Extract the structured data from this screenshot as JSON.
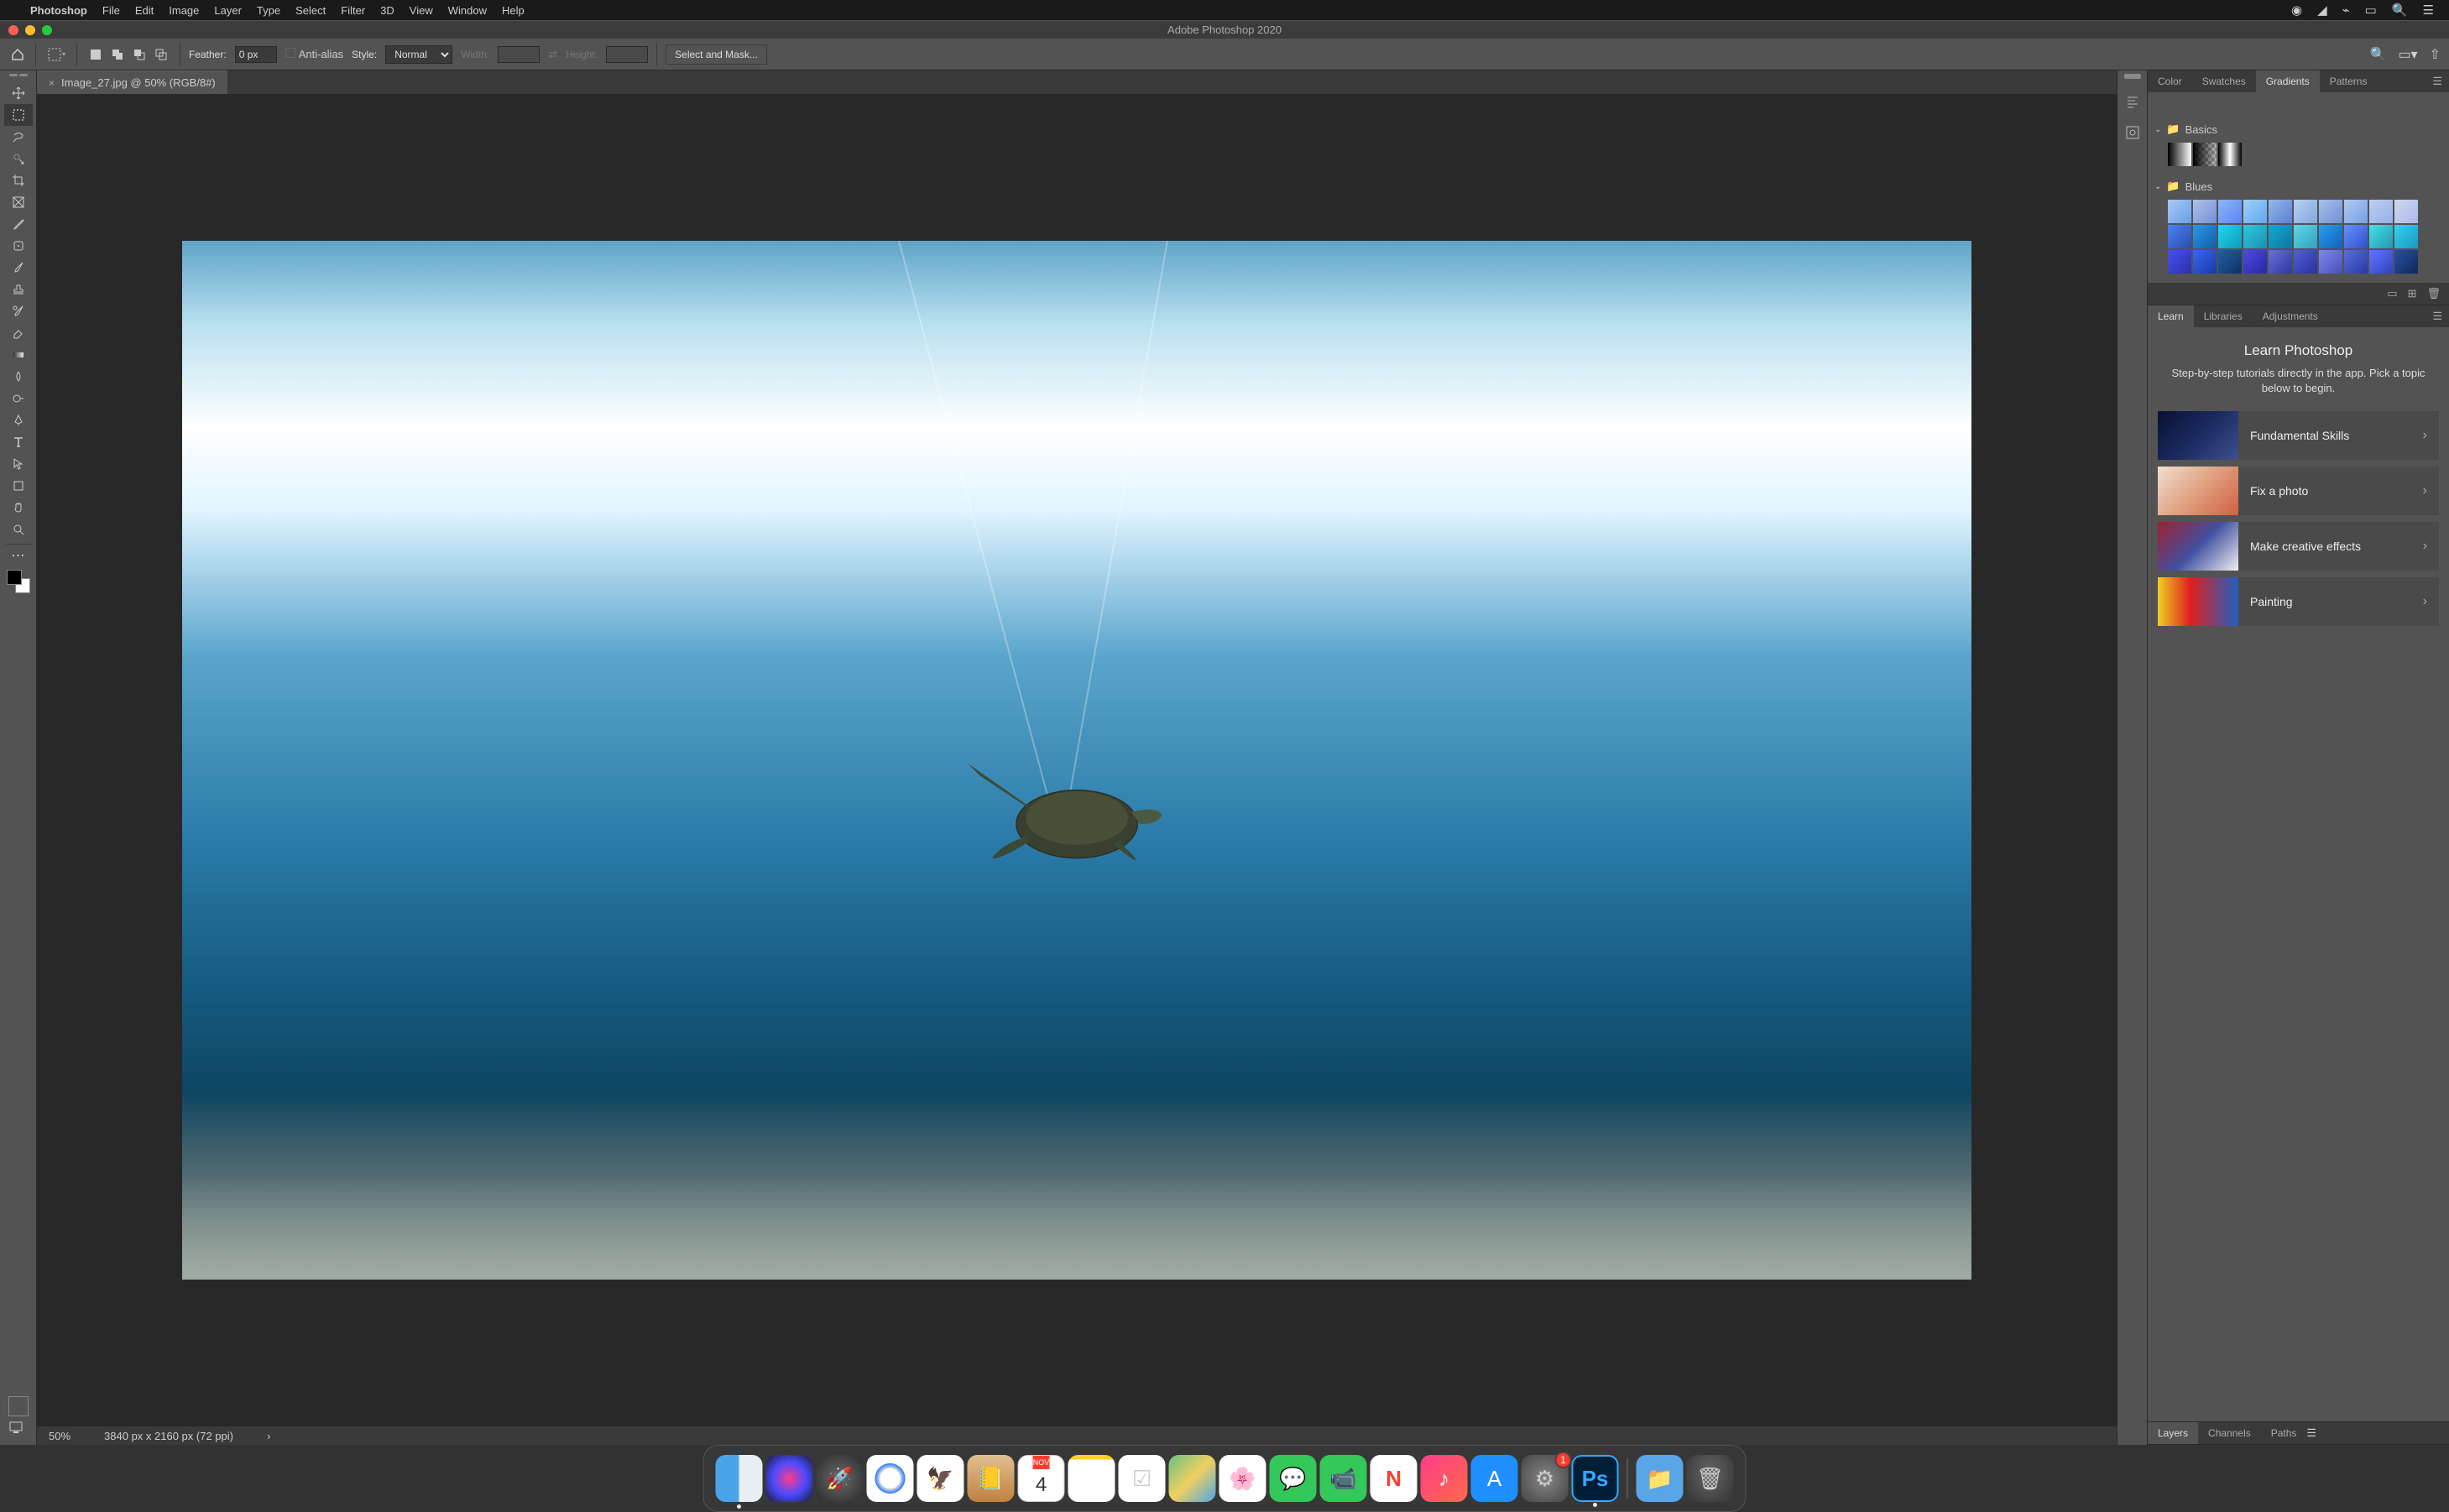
{
  "menubar": {
    "app": "Photoshop",
    "items": [
      "File",
      "Edit",
      "Image",
      "Layer",
      "Type",
      "Select",
      "Filter",
      "3D",
      "View",
      "Window",
      "Help"
    ]
  },
  "window": {
    "title": "Adobe Photoshop 2020"
  },
  "optbar": {
    "feather_label": "Feather:",
    "feather_value": "0 px",
    "antialias_label": "Anti-alias",
    "style_label": "Style:",
    "style_value": "Normal",
    "width_label": "Width:",
    "height_label": "Height:",
    "select_mask": "Select and Mask..."
  },
  "document": {
    "tab": "Image_27.jpg @ 50% (RGB/8#)",
    "zoom": "50%",
    "dim": "3840 px x 2160 px (72 ppi)"
  },
  "tools": [
    "move",
    "marquee",
    "lasso",
    "quick-select",
    "crop",
    "frame",
    "eyedropper",
    "patch",
    "brush",
    "stamp",
    "history-brush",
    "eraser",
    "gradient",
    "blur",
    "dodge",
    "pen",
    "type",
    "path-select",
    "shape",
    "hand",
    "zoom"
  ],
  "panels": {
    "top_tabs": [
      "Color",
      "Swatches",
      "Gradients",
      "Patterns"
    ],
    "gradients": {
      "folders": [
        {
          "name": "Basics",
          "swatches": [
            "gbasic1",
            "gbasic2",
            "gbasic3"
          ]
        },
        {
          "name": "Blues",
          "colors": [
            [
              "#a8c8f4",
              "#68a0e8"
            ],
            [
              "#b4c0e8",
              "#7090d8"
            ],
            [
              "#90b4f8",
              "#5888f0"
            ],
            [
              "#a0d0f8",
              "#60a8f0"
            ],
            [
              "#98b8e8",
              "#5880d8"
            ],
            [
              "#b8d0f0",
              "#80a8e0"
            ],
            [
              "#a8c0e8",
              "#7090d8"
            ],
            [
              "#b0c8f0",
              "#78a0e8"
            ],
            [
              "#c0d0f0",
              "#90b0e8"
            ],
            [
              "#d0d8f0",
              "#a8b8e8"
            ],
            [
              "#4a80f8",
              "#2a50a8"
            ],
            [
              "#2a98e8",
              "#1060a8"
            ],
            [
              "#20d8f0",
              "#1098b8"
            ],
            [
              "#30c8e0",
              "#1890b0"
            ],
            [
              "#18a8d0",
              "#0a78a0"
            ],
            [
              "#60d8e8",
              "#30a0c0"
            ],
            [
              "#28a0f0",
              "#1060b8"
            ],
            [
              "#6890ff",
              "#3050c8"
            ],
            [
              "#48e0e8",
              "#2098b0"
            ],
            [
              "#38d0f0",
              "#1898c0"
            ],
            [
              "#4a50f0",
              "#2a30a8"
            ],
            [
              "#3868f0",
              "#1838a8"
            ],
            [
              "#2060a8",
              "#103060"
            ],
            [
              "#5048e8",
              "#2828a0"
            ],
            [
              "#6870e0",
              "#30389a"
            ],
            [
              "#5060d8",
              "#283098"
            ],
            [
              "#8088f0",
              "#4850b8"
            ],
            [
              "#5870e0",
              "#2838a0"
            ],
            [
              "#6078ff",
              "#3040c0"
            ],
            [
              "#2850a8",
              "#102858"
            ]
          ]
        }
      ]
    },
    "mid_tabs": [
      "Learn",
      "Libraries",
      "Adjustments"
    ],
    "learn": {
      "title": "Learn Photoshop",
      "subtitle": "Step-by-step tutorials directly in the app. Pick a topic below to begin.",
      "cards": [
        "Fundamental Skills",
        "Fix a photo",
        "Make creative effects",
        "Painting"
      ]
    },
    "bottom_tabs": [
      "Layers",
      "Channels",
      "Paths"
    ]
  },
  "dock": {
    "cal_month": "NOV",
    "cal_day": "4",
    "ps_badge": "1"
  }
}
